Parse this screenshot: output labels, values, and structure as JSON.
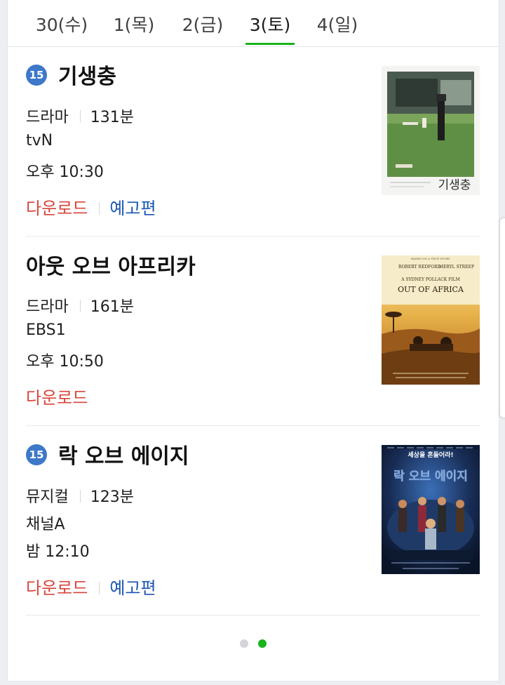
{
  "tabs": [
    {
      "label": "30(수)"
    },
    {
      "label": "1(목)"
    },
    {
      "label": "2(금)"
    },
    {
      "label": "3(토)",
      "active": true
    },
    {
      "label": "4(일)"
    }
  ],
  "movies": [
    {
      "age_rating": "15",
      "title": "기생충",
      "genre": "드라마",
      "runtime": "131분",
      "channel": "tvN",
      "time": "오후 10:30",
      "download_label": "다운로드",
      "trailer_label": "예고편",
      "poster_title": "기생충"
    },
    {
      "title": "아웃 오브 아프리카",
      "genre": "드라마",
      "runtime": "161분",
      "channel": "EBS1",
      "time": "오후 10:50",
      "download_label": "다운로드",
      "poster_title": "OUT OF AFRICA",
      "poster_top": "BASED ON A TRUE STORY",
      "poster_actor1": "ROBERT REDFORD",
      "poster_actor2": "MERYL STREEP",
      "poster_director": "A SYDNEY POLLACK FILM"
    },
    {
      "age_rating": "15",
      "title": "락 오브 에이지",
      "genre": "뮤지컬",
      "runtime": "123분",
      "channel": "채널A",
      "time": "밤 12:10",
      "download_label": "다운로드",
      "trailer_label": "예고편",
      "poster_title": "락 오브 에이지",
      "poster_tagline": "세상을 흔들어라!"
    }
  ],
  "pagination": {
    "pages": 2,
    "current": 2
  },
  "colors": {
    "accent_green": "#19b41b",
    "age_badge_blue": "#3d78c9",
    "download_red": "#d8453c",
    "trailer_blue": "#1b56b5"
  }
}
